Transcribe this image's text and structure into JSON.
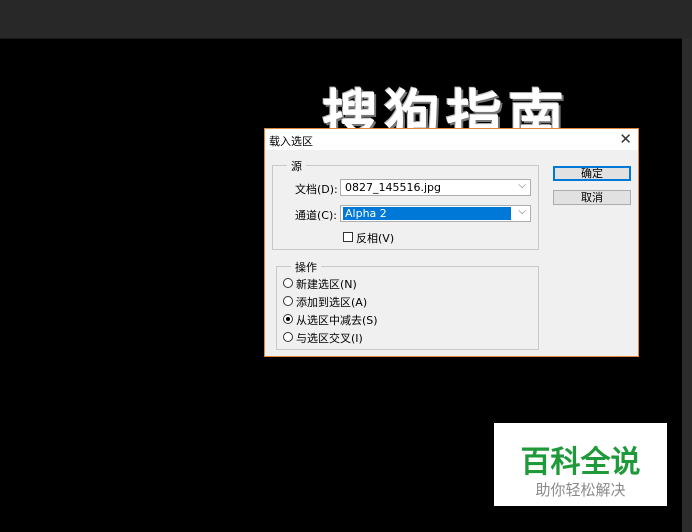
{
  "canvas": {
    "text": "搜狗指南"
  },
  "dialog": {
    "title": "载入选区",
    "close_glyph": "✕",
    "source_group": {
      "legend": "源",
      "document_label": "文档(D):",
      "document_value": "0827_145516.jpg",
      "channel_label": "通道(C):",
      "channel_value": "Alpha 2",
      "invert_label": "反相(V)",
      "invert_checked": false
    },
    "operation_group": {
      "legend": "操作",
      "options": [
        {
          "label": "新建选区(N)",
          "checked": false
        },
        {
          "label": "添加到选区(A)",
          "checked": false
        },
        {
          "label": "从选区中减去(S)",
          "checked": true
        },
        {
          "label": "与选区交叉(I)",
          "checked": false
        }
      ]
    },
    "ok_label": "确定",
    "cancel_label": "取消"
  },
  "watermark": {
    "main": "百科全说",
    "sub": "助你轻松解决"
  },
  "colors": {
    "accent": "#0078d7",
    "dialog_border": "#e0863a",
    "watermark_green": "#1f9a3a"
  }
}
